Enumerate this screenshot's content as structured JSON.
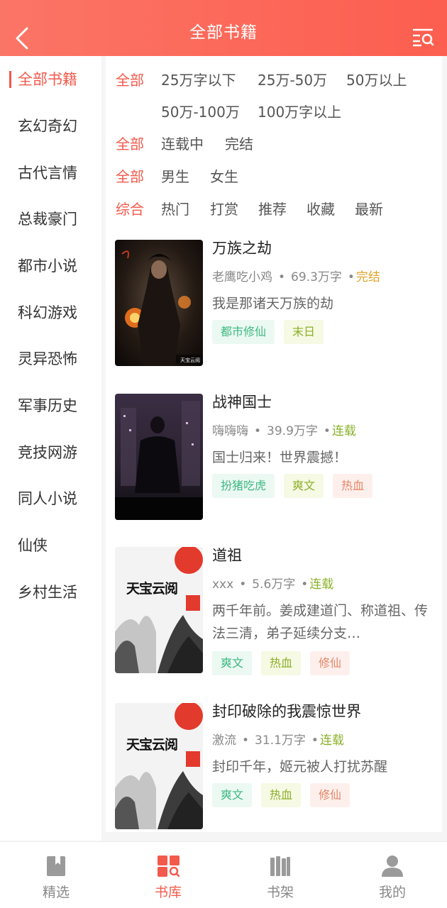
{
  "header": {
    "title": "全部书籍"
  },
  "sidebar": {
    "items": [
      {
        "label": "全部书籍"
      },
      {
        "label": "玄幻奇幻"
      },
      {
        "label": "古代言情"
      },
      {
        "label": "总裁豪门"
      },
      {
        "label": "都市小说"
      },
      {
        "label": "科幻游戏"
      },
      {
        "label": "灵异恐怖"
      },
      {
        "label": "军事历史"
      },
      {
        "label": "竞技网游"
      },
      {
        "label": "同人小说"
      },
      {
        "label": "仙侠"
      },
      {
        "label": "乡村生活"
      }
    ]
  },
  "filters": {
    "words": [
      "全部",
      "25万字以下",
      "25万-50万",
      "50万以上",
      "50万-100万",
      "100万字以上"
    ],
    "status": [
      "全部",
      "连载中",
      "完结"
    ],
    "gender": [
      "全部",
      "男生",
      "女生"
    ],
    "sort": [
      "综合",
      "热门",
      "打赏",
      "推荐",
      "收藏",
      "最新"
    ]
  },
  "books": [
    {
      "title": "万族之劫",
      "author": "老鹰吃小鸡",
      "words": "69.3万字",
      "status": "完结",
      "desc": "我是那诸天万族的劫",
      "tags": [
        "都市修仙",
        "末日"
      ],
      "cover_text": "天宝云阅"
    },
    {
      "title": "战神国士",
      "author": "嗨嗨嗨",
      "words": "39.9万字",
      "status": "连载",
      "desc": "国士归来！世界震撼！",
      "tags": [
        "扮猪吃虎",
        "爽文",
        "热血"
      ]
    },
    {
      "title": "道祖",
      "author": "xxx",
      "words": "5.6万字",
      "status": "连载",
      "desc": "两千年前。姜成建道门、称道祖、传法三清，弟子延续分支…",
      "tags": [
        "爽文",
        "热血",
        "修仙"
      ],
      "cover_text": "天宝云阅"
    },
    {
      "title": "封印破除的我震惊世界",
      "author": "激流",
      "words": "31.1万字",
      "status": "连载",
      "desc": "封印千年，姬元被人打扰苏醒",
      "tags": [
        "爽文",
        "热血",
        "修仙"
      ],
      "cover_text": "天宝云阅"
    }
  ],
  "tabbar": [
    {
      "label": "精选"
    },
    {
      "label": "书库"
    },
    {
      "label": "书架"
    },
    {
      "label": "我的"
    }
  ],
  "colors": {
    "accent": "#f25a4c",
    "header_from": "#fb7566",
    "header_to": "#fc5e4f"
  }
}
